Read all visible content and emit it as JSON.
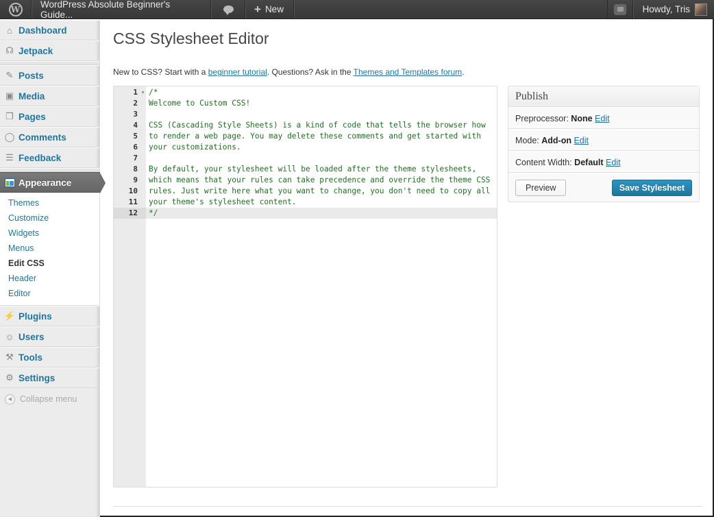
{
  "adminbar": {
    "logo_icon": "wordpress-logo-icon",
    "site_name": "WordPress Absolute Beginner's Guide...",
    "comments_icon": "comment-bubble-icon",
    "new_label": "New",
    "notifications_icon": "notifications-icon",
    "account_label": "Howdy, Tris"
  },
  "sidebar": {
    "top_items": [
      {
        "label": "Dashboard",
        "icon": "home-icon"
      },
      {
        "label": "Jetpack",
        "icon": "jetpack-icon"
      }
    ],
    "mid_items": [
      {
        "label": "Posts",
        "icon": "pushpin-icon"
      },
      {
        "label": "Media",
        "icon": "media-icon"
      },
      {
        "label": "Pages",
        "icon": "pages-icon"
      },
      {
        "label": "Comments",
        "icon": "comment-icon"
      },
      {
        "label": "Feedback",
        "icon": "feedback-icon"
      }
    ],
    "current": {
      "label": "Appearance",
      "icon": "appearance-icon"
    },
    "submenu": [
      {
        "label": "Themes",
        "active": false
      },
      {
        "label": "Customize",
        "active": false
      },
      {
        "label": "Widgets",
        "active": false
      },
      {
        "label": "Menus",
        "active": false
      },
      {
        "label": "Edit CSS",
        "active": true
      },
      {
        "label": "Header",
        "active": false
      },
      {
        "label": "Editor",
        "active": false
      }
    ],
    "bottom_items": [
      {
        "label": "Plugins",
        "icon": "plugin-icon"
      },
      {
        "label": "Users",
        "icon": "users-icon"
      },
      {
        "label": "Tools",
        "icon": "tools-icon"
      },
      {
        "label": "Settings",
        "icon": "settings-icon"
      }
    ],
    "collapse_label": "Collapse menu"
  },
  "main": {
    "title": "CSS Stylesheet Editor",
    "intro": {
      "text1": "New to CSS? Start with a ",
      "link1": "beginner tutorial",
      "text2": ". Questions? Ask in the ",
      "link2": "Themes and Templates forum",
      "text3": "."
    }
  },
  "editor": {
    "active_line": 12,
    "lines": [
      {
        "n": "1",
        "text": "/*",
        "fold": true
      },
      {
        "n": "2",
        "text": "Welcome to Custom CSS!"
      },
      {
        "n": "3",
        "text": ""
      },
      {
        "n": "4",
        "text": "CSS (Cascading Style Sheets) is a kind of code that tells the browser how"
      },
      {
        "n": "5",
        "text": "to render a web page. You may delete these comments and get started with"
      },
      {
        "n": "6",
        "text": "your customizations."
      },
      {
        "n": "7",
        "text": ""
      },
      {
        "n": "8",
        "text": "By default, your stylesheet will be loaded after the theme stylesheets,"
      },
      {
        "n": "9",
        "text": "which means that your rules can take precedence and override the theme CSS"
      },
      {
        "n": "10",
        "text": "rules. Just write here what you want to change, you don't need to copy all"
      },
      {
        "n": "11",
        "text": "your theme's stylesheet content."
      },
      {
        "n": "12",
        "text": "*/"
      }
    ]
  },
  "publish": {
    "title": "Publish",
    "rows": [
      {
        "label": "Preprocessor:",
        "value": "None",
        "link": "Edit"
      },
      {
        "label": "Mode:",
        "value": "Add-on",
        "link": "Edit"
      },
      {
        "label": "Content Width:",
        "value": "Default",
        "link": "Edit"
      }
    ],
    "preview_label": "Preview",
    "save_label": "Save Stylesheet"
  },
  "colors": {
    "link": "#21759b",
    "code_text": "#236e25",
    "adminbar": "#464646",
    "primary_button": "#21759b"
  }
}
